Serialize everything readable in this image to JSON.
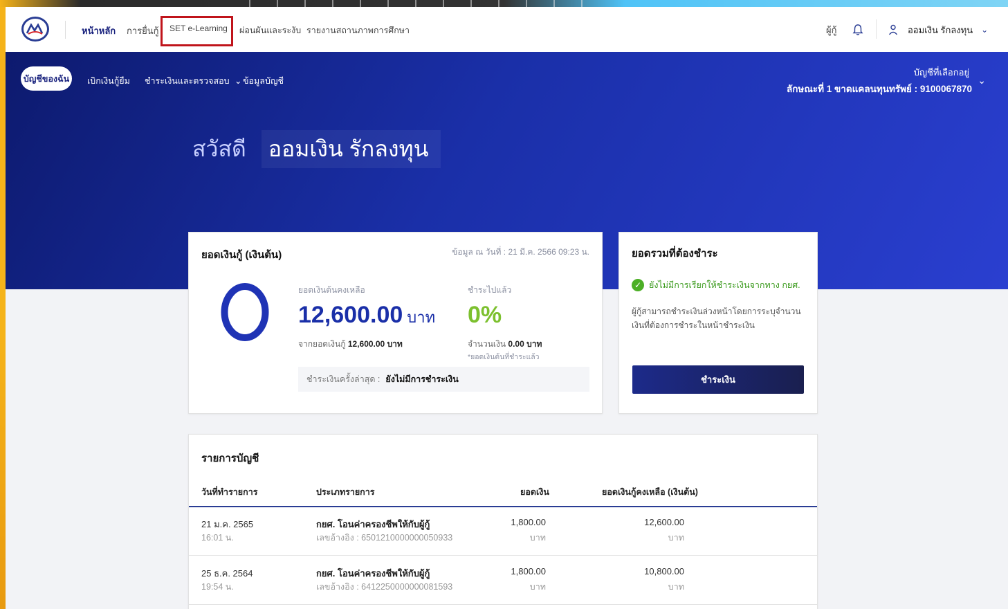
{
  "topnav": {
    "items": [
      "หน้าหลัก",
      "การยื่นกู้",
      "SET e-Learning",
      "ผ่อนผันและระงับ",
      "รายงานสถานภาพการศึกษา"
    ],
    "borrower_label": "ผู้กู้",
    "user_name": "ออมเงิน รักลงทุน"
  },
  "subnav": {
    "items": [
      "บัญชีของฉัน",
      "เบิกเงินกู้ยืม",
      "ชำระเงินและตรวจสอบ",
      "ข้อมูลบัญชี"
    ],
    "selected_account_label": "บัญชีที่เลือกอยู่",
    "selected_account_value": "ลักษณะที่ 1 ขาดแคลนทุนทรัพย์ : 9100067870"
  },
  "greeting": {
    "hello": "สวัสดี",
    "name": "ออมเงิน รักลงทุน"
  },
  "loan_card": {
    "title": "ยอดเงินกู้ (เงินต้น)",
    "as_of": "ข้อมูล ณ วันที่ : 21 มี.ค. 2566 09:23 น.",
    "remaining_label": "ยอดเงินต้นคงเหลือ",
    "remaining_amount": "12,600.00",
    "remaining_unit": "บาท",
    "from_total_prefix": "จากยอดเงินกู้",
    "from_total_value": "12,600.00 บาท",
    "paid_label": "ชำระไปแล้ว",
    "paid_percent": "0%",
    "paid_fraction": 0,
    "paid_amount_prefix": "จำนวนเงิน",
    "paid_amount_value": "0.00 บาท",
    "paid_note": "*ยอดเงินต้นที่ชำระแล้ว",
    "last_payment_label": "ชำระเงินครั้งล่าสุด :",
    "last_payment_value": "ยังไม่มีการชำระเงิน"
  },
  "due_card": {
    "title": "ยอดรวมที่ต้องชำระ",
    "status": "ยังไม่มีการเรียกให้ชำระเงินจากทาง กยศ.",
    "description": "ผู้กู้สามารถชำระเงินล่วงหน้าโดยการระบุจำนวนเงินที่ต้องการชำระในหน้าชำระเงิน",
    "pay_button": "ชำระเงิน"
  },
  "statement": {
    "title": "รายการบัญชี",
    "columns": [
      "วันที่ทำรายการ",
      "ประเภทรายการ",
      "ยอดเงิน",
      "ยอดเงินกู้คงเหลือ (เงินต้น)"
    ],
    "rows": [
      {
        "date": "21 ม.ค. 2565",
        "time": "16:01 น.",
        "type": "กยศ. โอนค่าครองชีพให้กับผู้กู้",
        "ref": "เลขอ้างอิง : 6501210000000050933",
        "amount": "1,800.00",
        "amount_unit": "บาท",
        "balance": "12,600.00",
        "balance_unit": "บาท"
      },
      {
        "date": "25 ธ.ค. 2564",
        "time": "19:54 น.",
        "type": "กยศ. โอนค่าครองชีพให้กับผู้กู้",
        "ref": "เลขอ้างอิง : 6412250000000081593",
        "amount": "1,800.00",
        "amount_unit": "บาท",
        "balance": "10,800.00",
        "balance_unit": "บาท"
      }
    ]
  },
  "colors": {
    "primary": "#1a2fa8",
    "hero_dark": "#0d1a6e",
    "success": "#7cc02e",
    "highlight": "#c0141b"
  }
}
